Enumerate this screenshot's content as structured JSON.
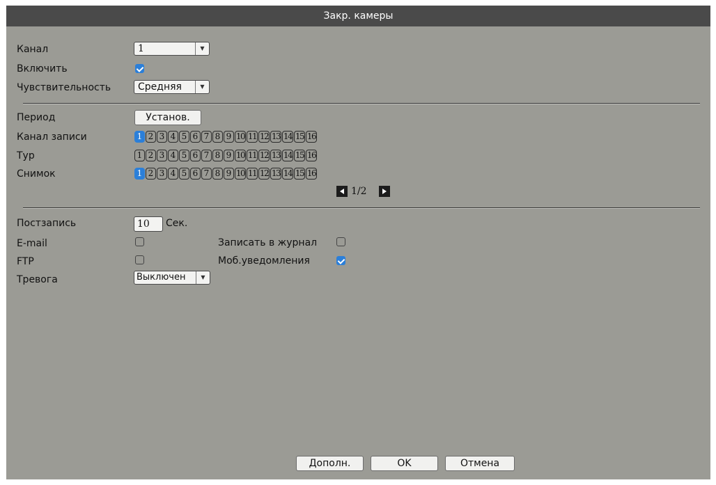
{
  "window": {
    "title": "Закр. камеры"
  },
  "form": {
    "channel": {
      "label": "Канал",
      "value": "1"
    },
    "enable": {
      "label": "Включить",
      "checked": true
    },
    "sensitivity": {
      "label": "Чувствительность",
      "value": "Средняя"
    },
    "period": {
      "label": "Период",
      "button": "Установ."
    },
    "record_channel": {
      "label": "Канал записи",
      "selected": [
        "1"
      ]
    },
    "tour": {
      "label": "Тур",
      "selected": []
    },
    "snapshot": {
      "label": "Снимок",
      "selected": [
        "1"
      ]
    },
    "channels": [
      "1",
      "2",
      "3",
      "4",
      "5",
      "6",
      "7",
      "8",
      "9",
      "10",
      "11",
      "12",
      "13",
      "14",
      "15",
      "16"
    ],
    "pager": {
      "text": "1/2"
    },
    "post_record": {
      "label": "Постзапись",
      "value": "10",
      "unit": "Сек."
    },
    "email": {
      "label": "E-mail",
      "checked": false
    },
    "ftp": {
      "label": "FTP",
      "checked": false
    },
    "write_log": {
      "label": "Записать в журнал",
      "checked": false
    },
    "mobile_notify": {
      "label": "Моб.уведомления",
      "checked": true
    },
    "alarm": {
      "label": "Тревога",
      "value": "Выключен"
    }
  },
  "footer": {
    "more": "Дополн.",
    "ok": "OK",
    "cancel": "Отмена"
  },
  "colors": {
    "panel": "#9b9b95",
    "titlebar": "#4a4a4a",
    "accent": "#2b7fd9"
  }
}
